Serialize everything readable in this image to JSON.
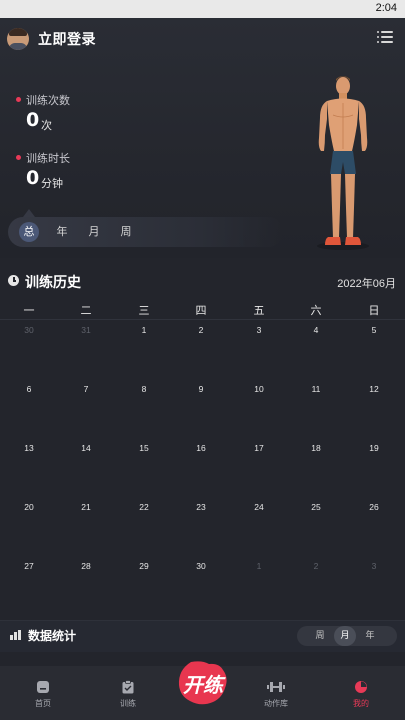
{
  "status_bar": {
    "time": "2:04"
  },
  "header": {
    "login_text": "立即登录",
    "avatar_icon": "user-avatar",
    "menu_icon": "list-menu-icon"
  },
  "stats": {
    "count_label": "训练次数",
    "count_value": "0",
    "count_unit": "次",
    "duration_label": "训练时长",
    "duration_value": "0",
    "duration_unit": "分钟",
    "accent_color": "#e83a57"
  },
  "period_tabs": [
    "总",
    "年",
    "月",
    "周"
  ],
  "period_tabs_selected": "总",
  "history": {
    "title": "训练历史",
    "month": "2022年06月",
    "weekdays": [
      "一",
      "二",
      "三",
      "四",
      "五",
      "六",
      "日"
    ],
    "weeks": [
      [
        "30",
        "31",
        "1",
        "2",
        "3",
        "4",
        "5"
      ],
      [
        "6",
        "7",
        "8",
        "9",
        "10",
        "11",
        "12"
      ],
      [
        "13",
        "14",
        "15",
        "16",
        "17",
        "18",
        "19"
      ],
      [
        "20",
        "21",
        "22",
        "23",
        "24",
        "25",
        "26"
      ],
      [
        "27",
        "28",
        "29",
        "30",
        "1",
        "2",
        "3"
      ]
    ]
  },
  "data_stats": {
    "title": "数据统计",
    "tabs": [
      "周",
      "月",
      "年"
    ],
    "selected": "月"
  },
  "tab_bar": {
    "items": [
      {
        "label": "首页",
        "icon": "home-icon"
      },
      {
        "label": "训练",
        "icon": "clipboard-icon"
      },
      {
        "label": "动作库",
        "icon": "dumbbell-icon"
      },
      {
        "label": "我的",
        "icon": "profile-icon"
      }
    ],
    "center_logo_text": "开练",
    "active_color": "#e83a57"
  }
}
